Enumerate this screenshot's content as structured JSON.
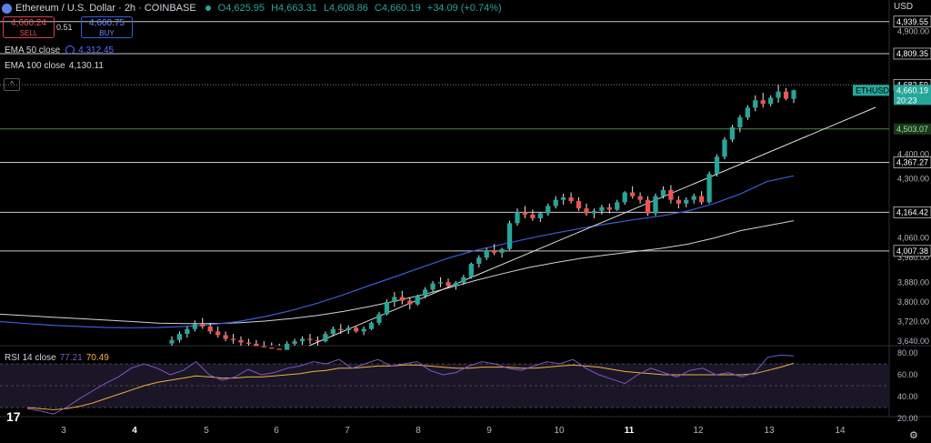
{
  "header": {
    "title": "Ethereum / U.S. Dollar · 2h · COINBASE",
    "open": "O4,625.95",
    "high": "H4,663.31",
    "low": "L4,608.86",
    "close": "C4,660.19",
    "change": "+34.09 (+0.74%)"
  },
  "trade": {
    "sell_price": "4,660.24",
    "sell_label": "SELL",
    "spread": "0.51",
    "buy_price": "4,660.75",
    "buy_label": "BUY"
  },
  "indicators": {
    "ema50_label": "EMA 50 close",
    "ema50_value": "4,312.45",
    "ema100_label": "EMA 100 close",
    "ema100_value": "4,130.11",
    "rsi_label": "RSI 14 close",
    "rsi_value": "77.21",
    "rsi_ma_value": "70.49"
  },
  "axis": {
    "currency": "USD"
  },
  "chart_data": {
    "type": "candlestick",
    "symbol": "ETHUSD",
    "last_price": "4,660.19",
    "countdown": "20:23",
    "price_ticks": [
      "3,640.00",
      "3,720.00",
      "3,800.00",
      "3,880.00",
      "3,980.00",
      "4,060.00",
      "4,300.00",
      "4,400.00",
      "4,900.00"
    ],
    "level_labels": [
      "4,939.55",
      "4,809.35",
      "4,682.59",
      "4,503.07",
      "4,367.27",
      "4,164.42",
      "4,007.38"
    ],
    "levels": [
      4939.55,
      4809.35,
      4682.59,
      4503.07,
      4367.27,
      4164.42,
      4007.38
    ],
    "x_ticks": [
      "3",
      "4",
      "5",
      "6",
      "7",
      "8",
      "9",
      "10",
      "11",
      "12",
      "13",
      "14"
    ],
    "rsi_ticks": [
      "80.00",
      "60.00",
      "40.00",
      "20.00"
    ],
    "colors": {
      "up": "#26a69a",
      "down": "#ef5350",
      "ema50": "#3c5bd4",
      "ema100": "#d1d4dc",
      "rsi": "#7e57c2",
      "rsi_ma": "#f2b03c",
      "level": "#ffffff"
    },
    "candles": [
      [
        3631,
        3660,
        3620,
        3645
      ],
      [
        3645,
        3680,
        3635,
        3670
      ],
      [
        3670,
        3700,
        3655,
        3690
      ],
      [
        3690,
        3725,
        3680,
        3710
      ],
      [
        3710,
        3735,
        3690,
        3700
      ],
      [
        3700,
        3715,
        3670,
        3680
      ],
      [
        3680,
        3700,
        3655,
        3665
      ],
      [
        3665,
        3680,
        3640,
        3650
      ],
      [
        3650,
        3670,
        3630,
        3645
      ],
      [
        3645,
        3660,
        3620,
        3635
      ],
      [
        3635,
        3650,
        3615,
        3630
      ],
      [
        3630,
        3645,
        3605,
        3620
      ],
      [
        3620,
        3640,
        3600,
        3615
      ],
      [
        3615,
        3635,
        3595,
        3610
      ],
      [
        3610,
        3630,
        3590,
        3605
      ],
      [
        3605,
        3640,
        3600,
        3630
      ],
      [
        3630,
        3650,
        3610,
        3640
      ],
      [
        3640,
        3660,
        3625,
        3650
      ],
      [
        3650,
        3670,
        3630,
        3645
      ],
      [
        3645,
        3660,
        3620,
        3640
      ],
      [
        3640,
        3680,
        3635,
        3670
      ],
      [
        3670,
        3700,
        3660,
        3690
      ],
      [
        3690,
        3710,
        3670,
        3685
      ],
      [
        3685,
        3705,
        3670,
        3695
      ],
      [
        3695,
        3700,
        3675,
        3680
      ],
      [
        3680,
        3700,
        3665,
        3690
      ],
      [
        3690,
        3720,
        3685,
        3715
      ],
      [
        3715,
        3760,
        3705,
        3750
      ],
      [
        3750,
        3810,
        3745,
        3800
      ],
      [
        3800,
        3840,
        3780,
        3820
      ],
      [
        3820,
        3845,
        3790,
        3805
      ],
      [
        3805,
        3820,
        3770,
        3790
      ],
      [
        3790,
        3830,
        3785,
        3825
      ],
      [
        3825,
        3860,
        3815,
        3850
      ],
      [
        3850,
        3885,
        3840,
        3875
      ],
      [
        3875,
        3900,
        3860,
        3880
      ],
      [
        3880,
        3895,
        3855,
        3865
      ],
      [
        3865,
        3885,
        3850,
        3878
      ],
      [
        3878,
        3910,
        3870,
        3900
      ],
      [
        3900,
        3960,
        3895,
        3955
      ],
      [
        3955,
        3990,
        3940,
        3980
      ],
      [
        3980,
        4020,
        3970,
        4010
      ],
      [
        4010,
        4035,
        3990,
        4000
      ],
      [
        4000,
        4020,
        3980,
        4015
      ],
      [
        4015,
        4130,
        4010,
        4120
      ],
      [
        4120,
        4180,
        4110,
        4165
      ],
      [
        4165,
        4190,
        4140,
        4155
      ],
      [
        4155,
        4175,
        4130,
        4140
      ],
      [
        4140,
        4165,
        4125,
        4160
      ],
      [
        4160,
        4200,
        4150,
        4190
      ],
      [
        4190,
        4230,
        4180,
        4215
      ],
      [
        4215,
        4240,
        4195,
        4225
      ],
      [
        4225,
        4245,
        4200,
        4210
      ],
      [
        4210,
        4225,
        4170,
        4180
      ],
      [
        4180,
        4200,
        4150,
        4160
      ],
      [
        4160,
        4180,
        4140,
        4170
      ],
      [
        4170,
        4195,
        4155,
        4185
      ],
      [
        4185,
        4200,
        4160,
        4175
      ],
      [
        4175,
        4215,
        4170,
        4205
      ],
      [
        4205,
        4250,
        4195,
        4245
      ],
      [
        4245,
        4270,
        4220,
        4230
      ],
      [
        4230,
        4245,
        4200,
        4215
      ],
      [
        4215,
        4230,
        4150,
        4160
      ],
      [
        4160,
        4240,
        4150,
        4230
      ],
      [
        4230,
        4270,
        4220,
        4255
      ],
      [
        4255,
        4275,
        4200,
        4215
      ],
      [
        4215,
        4230,
        4180,
        4200
      ],
      [
        4200,
        4225,
        4185,
        4215
      ],
      [
        4215,
        4240,
        4200,
        4230
      ],
      [
        4230,
        4250,
        4195,
        4205
      ],
      [
        4205,
        4330,
        4200,
        4320
      ],
      [
        4320,
        4400,
        4310,
        4390
      ],
      [
        4390,
        4470,
        4380,
        4460
      ],
      [
        4460,
        4520,
        4450,
        4510
      ],
      [
        4510,
        4560,
        4490,
        4550
      ],
      [
        4550,
        4600,
        4540,
        4590
      ],
      [
        4590,
        4640,
        4575,
        4620
      ],
      [
        4620,
        4650,
        4590,
        4605
      ],
      [
        4605,
        4640,
        4595,
        4630
      ],
      [
        4630,
        4683,
        4610,
        4655
      ],
      [
        4655,
        4670,
        4620,
        4626
      ],
      [
        4625.95,
        4663.31,
        4608.86,
        4660.19
      ]
    ],
    "ema50": [
      3720,
      3712,
      3705,
      3700,
      3696,
      3695,
      3696,
      3700,
      3708,
      3720,
      3740,
      3765,
      3795,
      3830,
      3868,
      3905,
      3943,
      3980,
      4010,
      4035,
      4058,
      4080,
      4100,
      4118,
      4135,
      4150,
      4170,
      4200,
      4240,
      4290,
      4312.45
    ],
    "ema100": [
      3750,
      3744,
      3738,
      3732,
      3726,
      3720,
      3714,
      3712,
      3712,
      3715,
      3722,
      3732,
      3745,
      3762,
      3782,
      3805,
      3830,
      3858,
      3888,
      3915,
      3940,
      3960,
      3978,
      3992,
      4005,
      4018,
      4035,
      4060,
      4090,
      4110,
      4130.11
    ],
    "rsi": [
      29,
      27,
      24,
      30,
      38,
      45,
      52,
      58,
      66,
      70,
      66,
      60,
      64,
      72,
      60,
      55,
      58,
      65,
      60,
      62,
      66,
      68,
      72,
      70,
      74,
      66,
      70,
      74,
      68,
      70,
      72,
      64,
      60,
      62,
      68,
      72,
      70,
      66,
      64,
      68,
      72,
      70,
      74,
      66,
      60,
      56,
      52,
      60,
      66,
      62,
      58,
      64,
      66,
      60,
      62,
      58,
      62,
      76,
      78,
      77.21
    ],
    "rsi_ma": [
      30,
      29,
      28,
      29,
      31,
      34,
      38,
      42,
      46,
      50,
      53,
      55,
      57,
      59,
      58,
      57,
      57,
      58,
      58,
      59,
      60,
      61,
      63,
      64,
      66,
      66,
      67,
      68,
      68,
      69,
      69,
      68,
      67,
      66,
      66,
      67,
      67,
      67,
      66,
      66,
      67,
      68,
      69,
      68,
      67,
      65,
      63,
      62,
      61,
      60,
      60,
      60,
      60,
      60,
      60,
      60,
      61,
      64,
      67,
      70.49
    ]
  }
}
